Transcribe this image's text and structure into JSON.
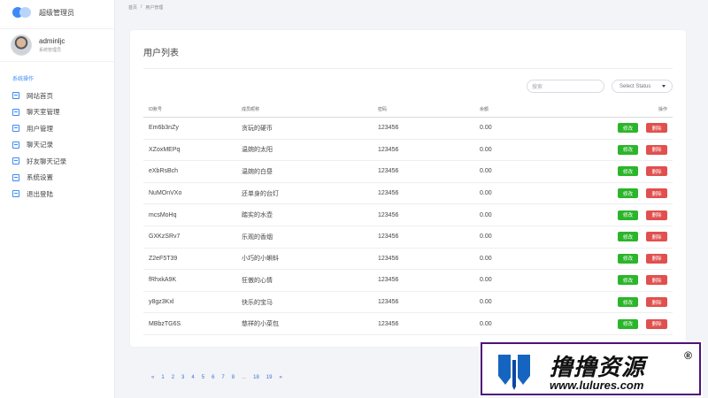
{
  "brand": {
    "title": "超级管理员"
  },
  "user": {
    "name": "adminljc",
    "role": "系统管理员"
  },
  "sidebar": {
    "heading": "系统操作",
    "items": [
      {
        "label": "网站首页"
      },
      {
        "label": "聊天室管理"
      },
      {
        "label": "用户管理"
      },
      {
        "label": "聊天记录"
      },
      {
        "label": "好友聊天记录"
      },
      {
        "label": "系统设置"
      },
      {
        "label": "退出登陆"
      }
    ]
  },
  "breadcrumb": {
    "home": "首页",
    "sep": "/",
    "current": "用户管理"
  },
  "card": {
    "title": "用户列表",
    "search_placeholder": "搜索",
    "status_select": "Select Status"
  },
  "table": {
    "headers": {
      "id": "ID账号",
      "nick": "成员昵称",
      "pw": "密码",
      "bal": "余额",
      "op": "操作"
    },
    "edit_label": "修改",
    "delete_label": "删除",
    "rows": [
      {
        "id": "Em6b3nZy",
        "nick": "贪玩的硬币",
        "pw": "123456",
        "bal": "0.00"
      },
      {
        "id": "XZoxMEPq",
        "nick": "温婉的太阳",
        "pw": "123456",
        "bal": "0.00"
      },
      {
        "id": "eXbRsBch",
        "nick": "温婉的白昼",
        "pw": "123456",
        "bal": "0.00"
      },
      {
        "id": "NuMOnVXo",
        "nick": "还单身的台灯",
        "pw": "123456",
        "bal": "0.00"
      },
      {
        "id": "mcsMoHq",
        "nick": "踏实的水壶",
        "pw": "123456",
        "bal": "0.00"
      },
      {
        "id": "GXKzSRv7",
        "nick": "乐观的香烟",
        "pw": "123456",
        "bal": "0.00"
      },
      {
        "id": "Z2eF5T39",
        "nick": "小巧的小蝌蚪",
        "pw": "123456",
        "bal": "0.00"
      },
      {
        "id": "fRhxkA9K",
        "nick": "狂傲的心情",
        "pw": "123456",
        "bal": "0.00"
      },
      {
        "id": "y8gz3Kxl",
        "nick": "快乐的宝马",
        "pw": "123456",
        "bal": "0.00"
      },
      {
        "id": "MBbzTG6S",
        "nick": "慈祥的小菜包",
        "pw": "123456",
        "bal": "0.00"
      }
    ]
  },
  "pagination": [
    "«",
    "1",
    "2",
    "3",
    "4",
    "5",
    "6",
    "7",
    "8",
    "...",
    "18",
    "19",
    "»"
  ],
  "watermark": {
    "title": "撸撸资源",
    "url": "www.lulures.com",
    "reg": "®"
  },
  "colors": {
    "accent": "#3d8af7",
    "edit": "#2bb52b",
    "delete": "#e0504e",
    "watermark_border": "#4d1478"
  }
}
